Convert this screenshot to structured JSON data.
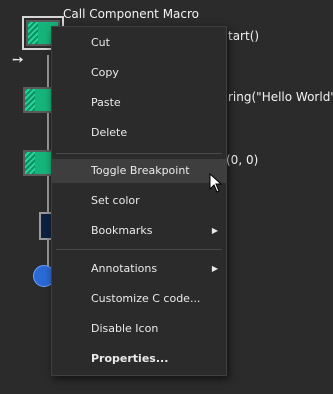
{
  "canvas": {
    "label_top": "Call Component Macro",
    "label_row1_right": "tart()",
    "label_row2_right": "ring(\"Hello World\")",
    "label_row3_right": "(0, 0)"
  },
  "context_menu": {
    "items": [
      {
        "label": "Cut"
      },
      {
        "label": "Copy"
      },
      {
        "label": "Paste"
      },
      {
        "label": "Delete"
      },
      {
        "label": "Toggle Breakpoint"
      },
      {
        "label": "Set color"
      },
      {
        "label": "Bookmarks",
        "submenu": true
      },
      {
        "label": "Annotations",
        "submenu": true
      },
      {
        "label": "Customize C code..."
      },
      {
        "label": "Disable Icon"
      },
      {
        "label": "Properties..."
      }
    ],
    "highlighted": "Toggle Breakpoint",
    "submenu_arrow_glyph": "▶"
  },
  "colors": {
    "background": "#2b2b2b",
    "block_green": "#15b47a",
    "menu_highlight": "#3e3e3e",
    "text": "#eaeaea"
  }
}
